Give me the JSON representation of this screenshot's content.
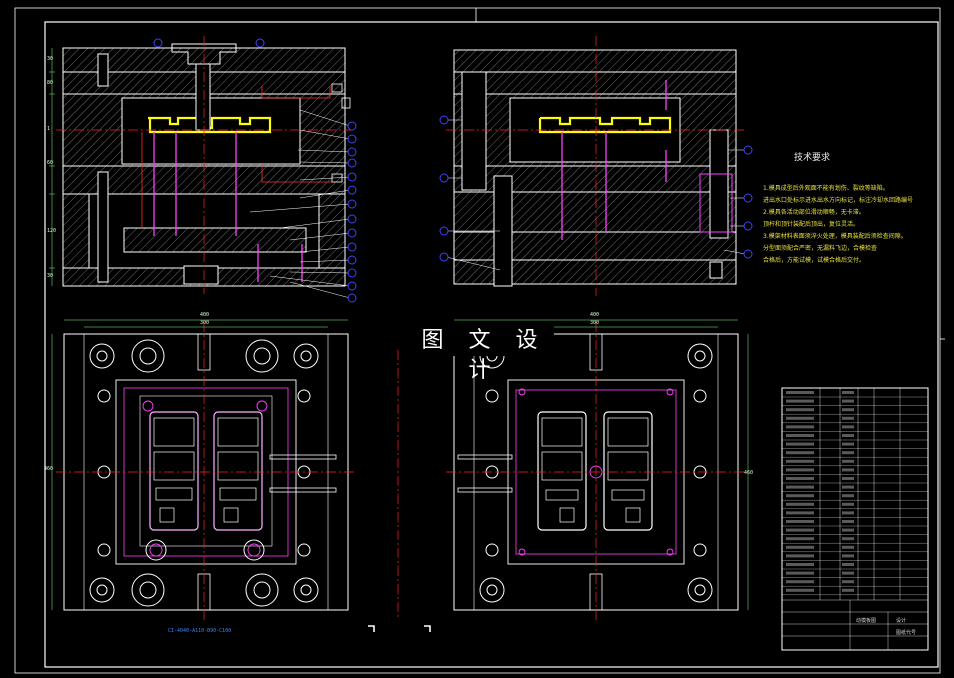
{
  "drawing": {
    "watermark": "图 文 设 计",
    "tech_requirements": {
      "title": "技术要求",
      "notes": [
        "1.模具成型后外观面不能有划伤、裂纹等缺陷。",
        "  进出水口处标示进水出水方向标记，标注冷却水回路编号。",
        "2.模具各活动部位滑动顺畅，无卡滞。",
        "  顶杆和顶针装配后顶出，复位灵活。",
        "3.模架材料表面须淬火处理，模具装配后须检查间隙。",
        "  分型面须配合严密，无漏料飞边，合模检查",
        "  合格后，方能试模，试模合格后交付。"
      ]
    },
    "dimensions": {
      "plate_width": "400",
      "inner_width": "300",
      "plate_height": "460"
    },
    "top_left_dims": [
      "30",
      "80",
      "1",
      "60",
      "120",
      "30"
    ],
    "mold_code": "CI-4040-A110-B90-C100",
    "title_block": {
      "name_cell": "动模板图",
      "drawing_no": "图纸代号",
      "designer": "设计"
    }
  },
  "colors": {
    "background": "#000000",
    "outline": "#ffffff",
    "hatch": "#b8b8b8",
    "cavity": "#ffff00",
    "centerline": "#ff2020",
    "callout": "#4040ff",
    "callout_dot": "#ff60ff",
    "pins": "#ff60ff",
    "cooling": "#00ffff",
    "frame": "#ffffff"
  }
}
